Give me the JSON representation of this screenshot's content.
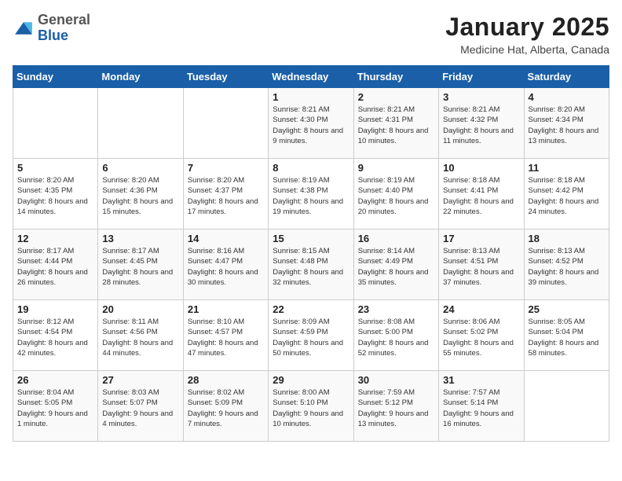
{
  "logo": {
    "general": "General",
    "blue": "Blue"
  },
  "title": "January 2025",
  "subtitle": "Medicine Hat, Alberta, Canada",
  "weekdays": [
    "Sunday",
    "Monday",
    "Tuesday",
    "Wednesday",
    "Thursday",
    "Friday",
    "Saturday"
  ],
  "weeks": [
    [
      {
        "day": "",
        "sunrise": "",
        "sunset": "",
        "daylight": ""
      },
      {
        "day": "",
        "sunrise": "",
        "sunset": "",
        "daylight": ""
      },
      {
        "day": "",
        "sunrise": "",
        "sunset": "",
        "daylight": ""
      },
      {
        "day": "1",
        "sunrise": "Sunrise: 8:21 AM",
        "sunset": "Sunset: 4:30 PM",
        "daylight": "Daylight: 8 hours and 9 minutes."
      },
      {
        "day": "2",
        "sunrise": "Sunrise: 8:21 AM",
        "sunset": "Sunset: 4:31 PM",
        "daylight": "Daylight: 8 hours and 10 minutes."
      },
      {
        "day": "3",
        "sunrise": "Sunrise: 8:21 AM",
        "sunset": "Sunset: 4:32 PM",
        "daylight": "Daylight: 8 hours and 11 minutes."
      },
      {
        "day": "4",
        "sunrise": "Sunrise: 8:20 AM",
        "sunset": "Sunset: 4:34 PM",
        "daylight": "Daylight: 8 hours and 13 minutes."
      }
    ],
    [
      {
        "day": "5",
        "sunrise": "Sunrise: 8:20 AM",
        "sunset": "Sunset: 4:35 PM",
        "daylight": "Daylight: 8 hours and 14 minutes."
      },
      {
        "day": "6",
        "sunrise": "Sunrise: 8:20 AM",
        "sunset": "Sunset: 4:36 PM",
        "daylight": "Daylight: 8 hours and 15 minutes."
      },
      {
        "day": "7",
        "sunrise": "Sunrise: 8:20 AM",
        "sunset": "Sunset: 4:37 PM",
        "daylight": "Daylight: 8 hours and 17 minutes."
      },
      {
        "day": "8",
        "sunrise": "Sunrise: 8:19 AM",
        "sunset": "Sunset: 4:38 PM",
        "daylight": "Daylight: 8 hours and 19 minutes."
      },
      {
        "day": "9",
        "sunrise": "Sunrise: 8:19 AM",
        "sunset": "Sunset: 4:40 PM",
        "daylight": "Daylight: 8 hours and 20 minutes."
      },
      {
        "day": "10",
        "sunrise": "Sunrise: 8:18 AM",
        "sunset": "Sunset: 4:41 PM",
        "daylight": "Daylight: 8 hours and 22 minutes."
      },
      {
        "day": "11",
        "sunrise": "Sunrise: 8:18 AM",
        "sunset": "Sunset: 4:42 PM",
        "daylight": "Daylight: 8 hours and 24 minutes."
      }
    ],
    [
      {
        "day": "12",
        "sunrise": "Sunrise: 8:17 AM",
        "sunset": "Sunset: 4:44 PM",
        "daylight": "Daylight: 8 hours and 26 minutes."
      },
      {
        "day": "13",
        "sunrise": "Sunrise: 8:17 AM",
        "sunset": "Sunset: 4:45 PM",
        "daylight": "Daylight: 8 hours and 28 minutes."
      },
      {
        "day": "14",
        "sunrise": "Sunrise: 8:16 AM",
        "sunset": "Sunset: 4:47 PM",
        "daylight": "Daylight: 8 hours and 30 minutes."
      },
      {
        "day": "15",
        "sunrise": "Sunrise: 8:15 AM",
        "sunset": "Sunset: 4:48 PM",
        "daylight": "Daylight: 8 hours and 32 minutes."
      },
      {
        "day": "16",
        "sunrise": "Sunrise: 8:14 AM",
        "sunset": "Sunset: 4:49 PM",
        "daylight": "Daylight: 8 hours and 35 minutes."
      },
      {
        "day": "17",
        "sunrise": "Sunrise: 8:13 AM",
        "sunset": "Sunset: 4:51 PM",
        "daylight": "Daylight: 8 hours and 37 minutes."
      },
      {
        "day": "18",
        "sunrise": "Sunrise: 8:13 AM",
        "sunset": "Sunset: 4:52 PM",
        "daylight": "Daylight: 8 hours and 39 minutes."
      }
    ],
    [
      {
        "day": "19",
        "sunrise": "Sunrise: 8:12 AM",
        "sunset": "Sunset: 4:54 PM",
        "daylight": "Daylight: 8 hours and 42 minutes."
      },
      {
        "day": "20",
        "sunrise": "Sunrise: 8:11 AM",
        "sunset": "Sunset: 4:56 PM",
        "daylight": "Daylight: 8 hours and 44 minutes."
      },
      {
        "day": "21",
        "sunrise": "Sunrise: 8:10 AM",
        "sunset": "Sunset: 4:57 PM",
        "daylight": "Daylight: 8 hours and 47 minutes."
      },
      {
        "day": "22",
        "sunrise": "Sunrise: 8:09 AM",
        "sunset": "Sunset: 4:59 PM",
        "daylight": "Daylight: 8 hours and 50 minutes."
      },
      {
        "day": "23",
        "sunrise": "Sunrise: 8:08 AM",
        "sunset": "Sunset: 5:00 PM",
        "daylight": "Daylight: 8 hours and 52 minutes."
      },
      {
        "day": "24",
        "sunrise": "Sunrise: 8:06 AM",
        "sunset": "Sunset: 5:02 PM",
        "daylight": "Daylight: 8 hours and 55 minutes."
      },
      {
        "day": "25",
        "sunrise": "Sunrise: 8:05 AM",
        "sunset": "Sunset: 5:04 PM",
        "daylight": "Daylight: 8 hours and 58 minutes."
      }
    ],
    [
      {
        "day": "26",
        "sunrise": "Sunrise: 8:04 AM",
        "sunset": "Sunset: 5:05 PM",
        "daylight": "Daylight: 9 hours and 1 minute."
      },
      {
        "day": "27",
        "sunrise": "Sunrise: 8:03 AM",
        "sunset": "Sunset: 5:07 PM",
        "daylight": "Daylight: 9 hours and 4 minutes."
      },
      {
        "day": "28",
        "sunrise": "Sunrise: 8:02 AM",
        "sunset": "Sunset: 5:09 PM",
        "daylight": "Daylight: 9 hours and 7 minutes."
      },
      {
        "day": "29",
        "sunrise": "Sunrise: 8:00 AM",
        "sunset": "Sunset: 5:10 PM",
        "daylight": "Daylight: 9 hours and 10 minutes."
      },
      {
        "day": "30",
        "sunrise": "Sunrise: 7:59 AM",
        "sunset": "Sunset: 5:12 PM",
        "daylight": "Daylight: 9 hours and 13 minutes."
      },
      {
        "day": "31",
        "sunrise": "Sunrise: 7:57 AM",
        "sunset": "Sunset: 5:14 PM",
        "daylight": "Daylight: 9 hours and 16 minutes."
      },
      {
        "day": "",
        "sunrise": "",
        "sunset": "",
        "daylight": ""
      }
    ]
  ]
}
